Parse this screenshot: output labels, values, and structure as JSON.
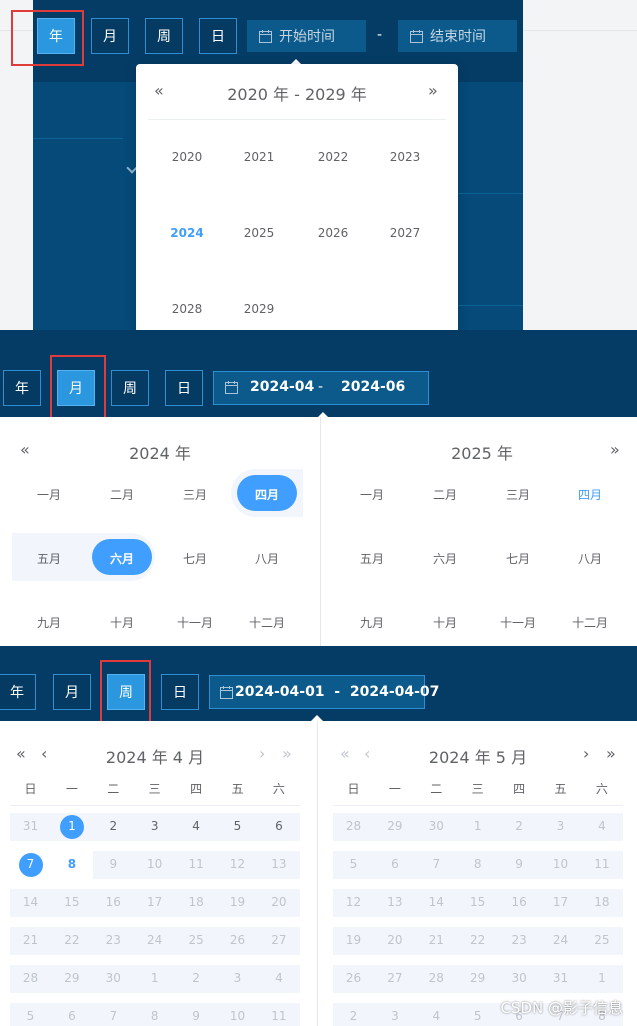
{
  "buttons": {
    "year": "年",
    "month": "月",
    "week": "周",
    "day": "日"
  },
  "year_panel": {
    "start_placeholder": "开始时间",
    "end_placeholder": "结束时间",
    "separator": "-",
    "prev_symbol": "«",
    "next_symbol": "»",
    "decade_title": "2020 年 - 2029 年",
    "years": [
      "2020",
      "2021",
      "2022",
      "2023",
      "2024",
      "2025",
      "2026",
      "2027",
      "2028",
      "2029"
    ],
    "current_year": "2024"
  },
  "month_panel": {
    "start_value": "2024-04",
    "end_value": "2024-06",
    "separator": "-",
    "prev_symbol": "«",
    "next_symbol": "»",
    "left_title": "2024 年",
    "right_title": "2025 年",
    "months": [
      "一月",
      "二月",
      "三月",
      "四月",
      "五月",
      "六月",
      "七月",
      "八月",
      "九月",
      "十月",
      "十一月",
      "十二月"
    ]
  },
  "week_panel": {
    "range_text": "2024-04-01  -  2024-04-07",
    "left_title": "2024 年 4 月",
    "right_title": "2024 年 5 月",
    "prev_year_symbol": "«",
    "prev_month_symbol": "‹",
    "next_month_symbol": "›",
    "next_year_symbol": "»",
    "weekdays": [
      "日",
      "一",
      "二",
      "三",
      "四",
      "五",
      "六"
    ],
    "left_weeks": [
      [
        "31",
        "1",
        "2",
        "3",
        "4",
        "5",
        "6"
      ],
      [
        "7",
        "8",
        "9",
        "10",
        "11",
        "12",
        "13"
      ],
      [
        "14",
        "15",
        "16",
        "17",
        "18",
        "19",
        "20"
      ],
      [
        "21",
        "22",
        "23",
        "24",
        "25",
        "26",
        "27"
      ],
      [
        "28",
        "29",
        "30",
        "1",
        "2",
        "3",
        "4"
      ],
      [
        "5",
        "6",
        "7",
        "8",
        "9",
        "10",
        "11"
      ]
    ],
    "right_weeks": [
      [
        "28",
        "29",
        "30",
        "1",
        "2",
        "3",
        "4"
      ],
      [
        "5",
        "6",
        "7",
        "8",
        "9",
        "10",
        "11"
      ],
      [
        "12",
        "13",
        "14",
        "15",
        "16",
        "17",
        "18"
      ],
      [
        "19",
        "20",
        "21",
        "22",
        "23",
        "24",
        "25"
      ],
      [
        "26",
        "27",
        "28",
        "29",
        "30",
        "31",
        "1"
      ],
      [
        "2",
        "3",
        "4",
        "5",
        "6",
        "7",
        "8"
      ]
    ]
  },
  "watermark": "CSDN @影子信息",
  "colors": {
    "dark_blue": "#053c66",
    "active_blue": "#2b97df",
    "accent": "#409eff",
    "highlight_red": "#e03b3b"
  }
}
